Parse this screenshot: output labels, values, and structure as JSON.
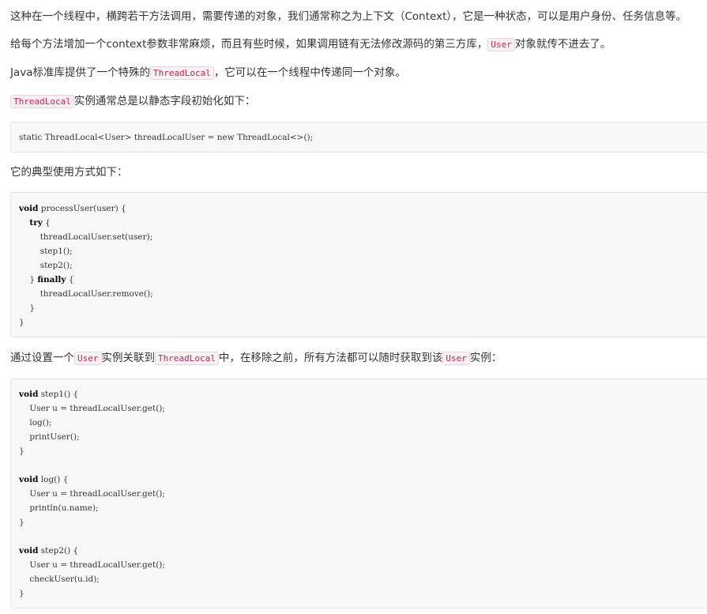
{
  "paragraphs": {
    "p1": "这种在一个线程中，横跨若干方法调用，需要传递的对象，我们通常称之为上下文（Context），它是一种状态，可以是用户身份、任务信息等。",
    "p2_a": "给每个方法增加一个context参数非常麻烦，而且有些时候，如果调用链有无法修改源码的第三方库，",
    "p2_code": "User",
    "p2_b": "对象就传不进去了。",
    "p3_a": "Java标准库提供了一个特殊的",
    "p3_code": "ThreadLocal",
    "p3_b": "，它可以在一个线程中传递同一个对象。",
    "p4_code": "ThreadLocal",
    "p4_b": "实例通常总是以静态字段初始化如下：",
    "p5": "它的典型使用方式如下：",
    "p6_a": "通过设置一个",
    "p6_code1": "User",
    "p6_b": "实例关联到",
    "p6_code2": "ThreadLocal",
    "p6_c": "中，在移除之前，所有方法都可以随时获取到该",
    "p6_code3": "User",
    "p6_d": "实例："
  },
  "code1": {
    "line1": "static ThreadLocal<User> threadLocalUser = new ThreadLocal<>();"
  },
  "code2": {
    "l1_kw": "void",
    "l1_rest": " processUser(user) {",
    "l2_indent": "    ",
    "l2_kw": "try",
    "l2_rest": " {",
    "l3": "        threadLocalUser.set(user);",
    "l4": "        step1();",
    "l5": "        step2();",
    "l6_a": "    } ",
    "l6_kw": "finally",
    "l6_b": " {",
    "l7": "        threadLocalUser.remove();",
    "l8": "    }",
    "l9": "}"
  },
  "code3": {
    "void_kw": "void",
    "a1_rest": " step1() {",
    "a2": "    User u = threadLocalUser.get();",
    "a3": "    log();",
    "a4": "    printUser();",
    "a5": "}",
    "b1_rest": " log() {",
    "b2": "    User u = threadLocalUser.get();",
    "b3": "    println(u.name);",
    "b4": "}",
    "c1_rest": " step2() {",
    "c2": "    User u = threadLocalUser.get();",
    "c3": "    checkUser(u.id);",
    "c4": "}"
  }
}
